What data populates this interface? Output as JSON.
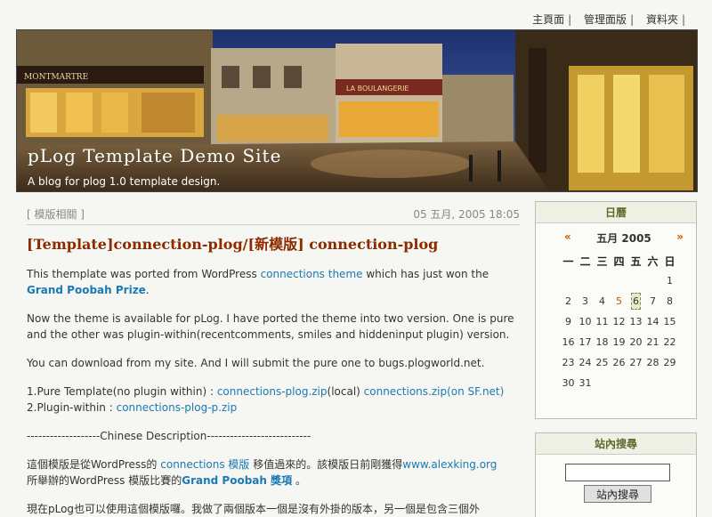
{
  "topnav": {
    "home": "主頁面",
    "admin": "管理面版",
    "archives": "資料夾",
    "sep": "|"
  },
  "banner": {
    "title": "pLog Template Demo Site",
    "description": "A blog for plog 1.0 template design.",
    "shop_sign_left": "MONTMARTRE",
    "shop_sign_right": "LA BOULANGERIE"
  },
  "post": {
    "category": "[ 模版相關 ]",
    "date": "05 五月, 2005 18:05",
    "title": "[Template]connection-plog/[新模版] connection-plog",
    "p1_a": "This themplate was ported from WordPress ",
    "p1_link": "connections theme",
    "p1_b": " which has just won the ",
    "p1_link2": "Grand Poobah Prize",
    "p1_c": ".",
    "p2": "Now the theme is available for pLog. I have ported the theme into two version. One is pure and the other was plugin-within(recentcomments, smiles and hiddeninput plugin) version.",
    "p3": "You can download from my site. And I will submit the pure one to bugs.plogworld.net.",
    "p4_a": "1.Pure Template(no plugin within) : ",
    "p4_link1": "connections-plog.zip",
    "p4_b": "(local) ",
    "p4_link2": "connections.zip(on SF.net)",
    "p4_c": "2.Plugin-within : ",
    "p4_link3": "connections-plog-p.zip",
    "divider": "-------------------Chinese Description---------------------------",
    "p5_a": "這個模版是從WordPress的 ",
    "p5_link1": "connections 模版",
    "p5_b": " 移值過來的。該模版日前剛獲得",
    "p5_link2": "www.alexking.org",
    "p5_c": "所舉辦的WordPress 模版比賽的",
    "p5_link3": "Grand Poobah 獎項",
    "p5_d": " 。",
    "p6": "現在pLog也可以使用這個模版囉。我做了兩個版本一個是沒有外掛的版本，另一個是包含三個外"
  },
  "calendar": {
    "heading": "日曆",
    "prev": "«",
    "next": "»",
    "month": "五月 2005",
    "weekdays": [
      "一",
      "二",
      "三",
      "四",
      "五",
      "六",
      "日"
    ],
    "weeks": [
      [
        "",
        "",
        "",
        "",
        "",
        "",
        "1"
      ],
      [
        "2",
        "3",
        "4",
        "5",
        "6",
        "7",
        "8"
      ],
      [
        "9",
        "10",
        "11",
        "12",
        "13",
        "14",
        "15"
      ],
      [
        "16",
        "17",
        "18",
        "19",
        "20",
        "21",
        "22"
      ],
      [
        "23",
        "24",
        "25",
        "26",
        "27",
        "28",
        "29"
      ],
      [
        "30",
        "31",
        "",
        "",
        "",
        "",
        ""
      ]
    ],
    "linked_days": [
      "5"
    ],
    "today": "6"
  },
  "search": {
    "heading": "站內搜尋",
    "button": "站內搜尋",
    "value": ""
  }
}
